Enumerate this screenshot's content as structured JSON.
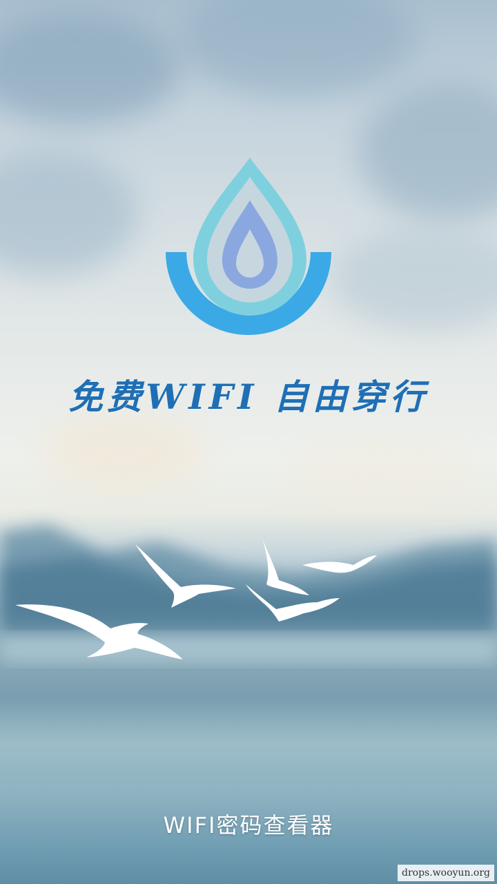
{
  "splash": {
    "tagline": "免费WIFI  自由穿行",
    "app_name": "WIFI密码查看器",
    "watermark": "drops.wooyun.org"
  },
  "colors": {
    "tagline": "#1f6fb5",
    "logo_outer": "#3aa9e6",
    "logo_middle": "#7fd0de",
    "logo_inner": "#8aa7e0",
    "app_name": "#ffffff"
  }
}
